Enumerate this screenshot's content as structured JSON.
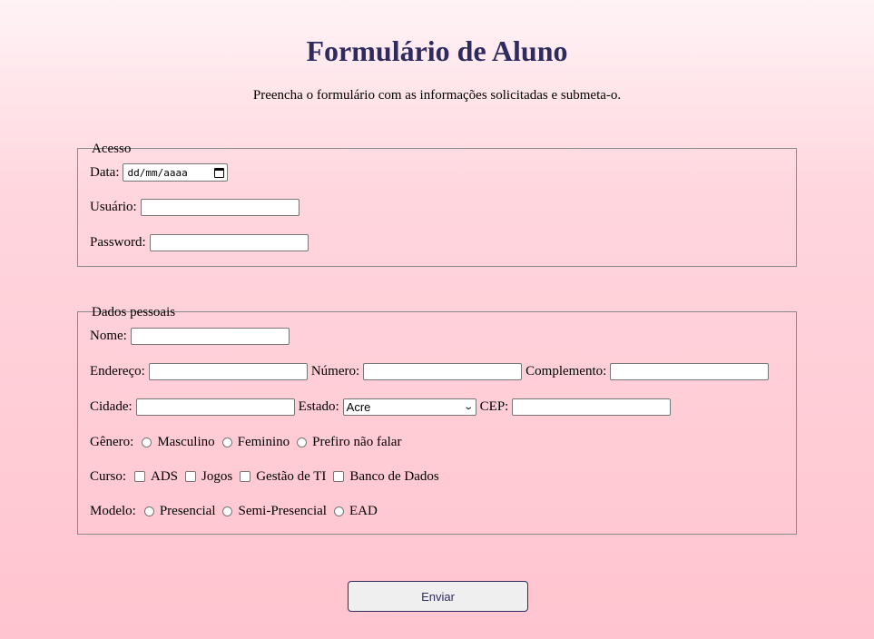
{
  "title": "Formulário de Aluno",
  "subtitle": "Preencha o formulário com as informações solicitadas e submeta-o.",
  "acesso": {
    "legend": "Acesso",
    "data_label": "Data:",
    "date_placeholder": "dd/mm/aaaa",
    "usuario_label": "Usuário:",
    "password_label": "Password:"
  },
  "dados": {
    "legend": "Dados pessoais",
    "nome_label": "Nome:",
    "endereco_label": "Endereço:",
    "numero_label": "Número:",
    "complemento_label": "Complemento:",
    "cidade_label": "Cidade:",
    "estado_label": "Estado:",
    "estado_value": "Acre",
    "cep_label": "CEP:",
    "genero_label": "Gênero:",
    "genero_options": [
      "Masculino",
      "Feminino",
      "Prefiro não falar"
    ],
    "curso_label": "Curso:",
    "curso_options": [
      "ADS",
      "Jogos",
      "Gestão de TI",
      "Banco de Dados"
    ],
    "modelo_label": "Modelo:",
    "modelo_options": [
      "Presencial",
      "Semi-Presencial",
      "EAD"
    ]
  },
  "submit_label": "Enviar",
  "colors": {
    "title": "#2e2b5f",
    "background_top": "#fff3f6",
    "background_bottom": "#ffc4cf"
  }
}
